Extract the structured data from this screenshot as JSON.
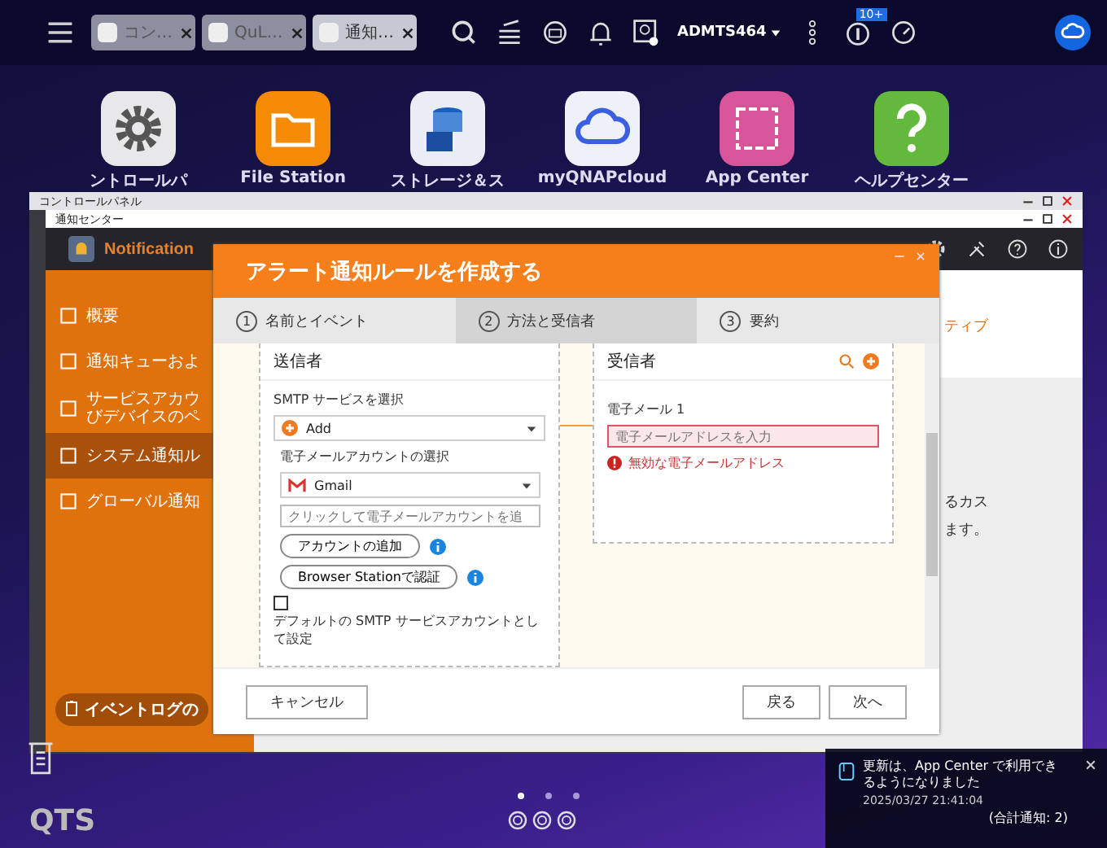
{
  "taskbar": {
    "tabs": [
      {
        "label": "コン…",
        "selected": false
      },
      {
        "label": "QuL…",
        "selected": false
      },
      {
        "label": "通知…",
        "selected": true
      }
    ],
    "user": "ADMTS464",
    "badge": "10+"
  },
  "desktop_icons": [
    {
      "label": "ントロールパ",
      "kind": "gear"
    },
    {
      "label": "File Station",
      "kind": "folder"
    },
    {
      "label": "ストレージ＆ス",
      "kind": "storage"
    },
    {
      "label": "myQNAPcloud",
      "kind": "cloud"
    },
    {
      "label": "App Center",
      "kind": "apps"
    },
    {
      "label": "ヘルプセンター",
      "kind": "help"
    }
  ],
  "control_panel_window": {
    "title": "コントロールパネル"
  },
  "notification_window": {
    "title": "通知センター",
    "app_title": "Notification",
    "sidebar": [
      {
        "lines": [
          "概要"
        ],
        "selected": false
      },
      {
        "lines": [
          "通知キューおよ"
        ],
        "selected": false
      },
      {
        "lines": [
          "サービスアカウ",
          "びデバイスのペ"
        ],
        "selected": false
      },
      {
        "lines": [
          "システム通知ル"
        ],
        "selected": true
      },
      {
        "lines": [
          "グローバル通知"
        ],
        "selected": false
      }
    ],
    "event_log_button": "イベントログの",
    "content_fragments": [
      "ティブ",
      "るカス",
      "ます。"
    ]
  },
  "dialog": {
    "title": "アラート通知ルールを作成する",
    "steps": [
      {
        "number": "1",
        "label": "名前とイベント",
        "selected": false
      },
      {
        "number": "2",
        "label": "方法と受信者",
        "selected": true
      },
      {
        "number": "3",
        "label": "要約",
        "selected": false
      }
    ],
    "sender": {
      "heading": "送信者",
      "smtp_label": "SMTP サービスを選択",
      "smtp_value": "Add",
      "account_label": "電子メールアカウントの選択",
      "account_value": "Gmail",
      "account_placeholder": "クリックして電子メールアカウントを追",
      "add_account": "アカウントの追加",
      "auth_button": "Browser Stationで認証",
      "default_checked": false,
      "default_label": "デフォルトの SMTP サービスアカウントとして設定"
    },
    "recipient": {
      "heading": "受信者",
      "email_label": "電子メール 1",
      "email_placeholder": "電子メールアドレスを入力",
      "error": "無効な電子メールアドレス"
    },
    "buttons": {
      "cancel": "キャンセル",
      "back": "戻る",
      "next": "次へ"
    }
  },
  "notification_toast": {
    "message": "更新は、App Center で利用できるようになりました",
    "time": "2025/03/27 21:41:04",
    "total": "(合計通知: 2)"
  },
  "brand": "QTS"
}
